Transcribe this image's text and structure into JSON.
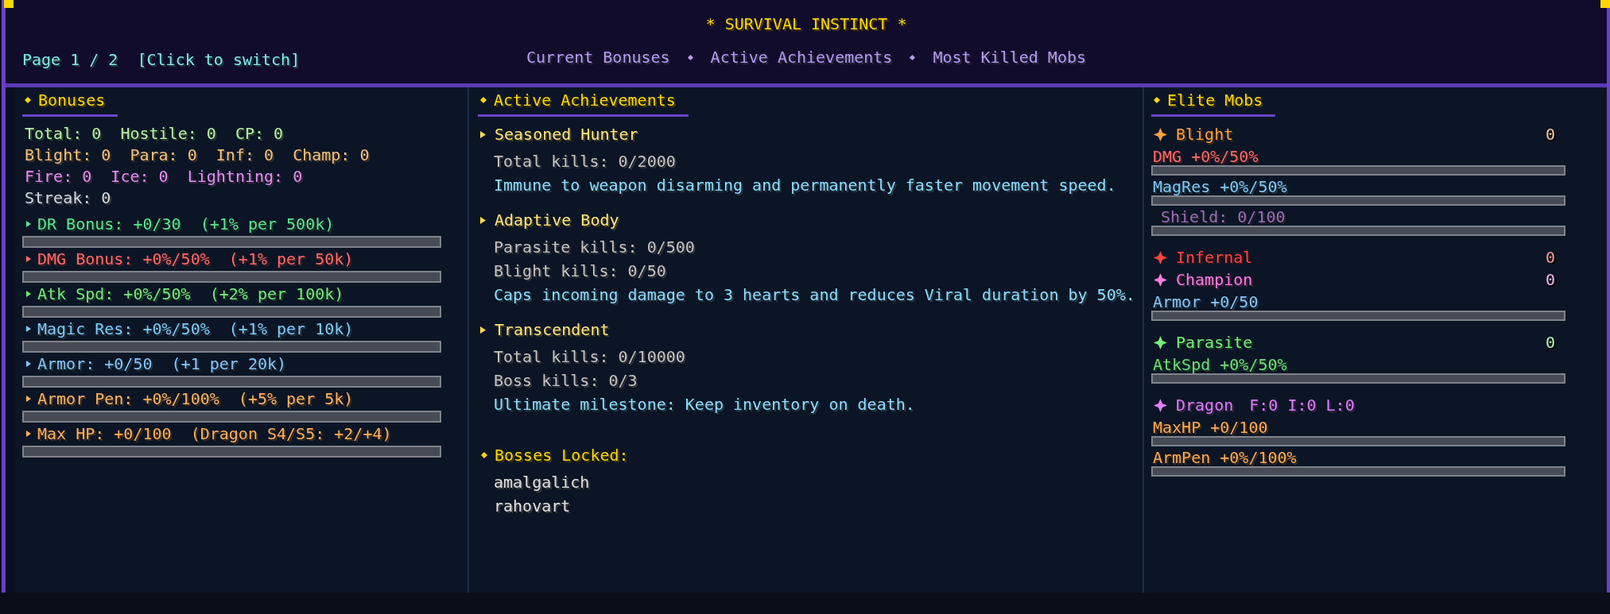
{
  "header": {
    "title": "* SURVIVAL INSTINCT *",
    "page_indicator": "Page 1 / 2  [Click to switch]",
    "nav": [
      "Current Bonuses",
      "Active Achievements",
      "Most Killed Mobs"
    ]
  },
  "bonuses": {
    "title": "Bonuses",
    "summary_lines": [
      {
        "text": "Total: 0  Hostile: 0  CP: 0",
        "color": "#b6f0a4"
      },
      {
        "text": "Blight: 0  Para: 0  Inf: 0  Champ: 0",
        "color": "#f2c27e"
      },
      {
        "text": "Fire: 0  Ice: 0  Lightning: 0",
        "color": "#e48ef2"
      },
      {
        "text": "Streak: 0",
        "color": "#d2dae8"
      }
    ],
    "rows": [
      {
        "label": "DR Bonus: +0/30  (+1% per 500k)",
        "color": "#5ee391",
        "level": 0
      },
      {
        "label": "DMG Bonus: +0%/50%  (+1% per 50k)",
        "color": "#ff6b6b",
        "level": 0
      },
      {
        "label": "Atk Spd: +0%/50%  (+2% per 100k)",
        "color": "#74ea7c",
        "level": 0
      },
      {
        "label": "Magic Res: +0%/50%  (+1% per 10k)",
        "color": "#7fc9f7",
        "level": 0
      },
      {
        "label": "Armor: +0/50  (+1 per 20k)",
        "color": "#86c6fa",
        "level": 0
      },
      {
        "label": "Armor Pen: +0%/100%  (+5% per 5k)",
        "color": "#ffb462",
        "level": 0
      },
      {
        "label": "Max HP: +0/100  (Dragon S4/S5: +2/+4)",
        "color": "#ffb05c",
        "level": 0
      }
    ]
  },
  "achievements": {
    "title": "Active Achievements",
    "items": [
      {
        "name": "Seasoned Hunter",
        "requirements": [
          "Total kills: 0/2000"
        ],
        "description": "Immune to weapon disarming and permanently faster movement speed."
      },
      {
        "name": "Adaptive Body",
        "requirements": [
          "Parasite kills: 0/500",
          "Blight kills: 0/50"
        ],
        "description": "Caps incoming damage to 3 hearts and reduces Viral duration by 50%."
      },
      {
        "name": "Transcendent",
        "requirements": [
          "Total kills: 0/10000",
          "Boss kills: 0/3"
        ],
        "description": "Ultimate milestone: Keep inventory on death."
      }
    ],
    "locked": {
      "title": "Bosses Locked:",
      "bosses": [
        "amalgalich",
        "rahovart"
      ]
    }
  },
  "elite_mobs": {
    "title": "Elite Mobs",
    "mobs": [
      {
        "name": "Blight",
        "color": "#ffa040",
        "count": "0",
        "stats": [
          {
            "kind": "stat",
            "label": "DMG +0%/50%",
            "color": "#ff6b6b",
            "level": 0
          },
          {
            "kind": "stat",
            "label": "MagRes +0%/50%",
            "color": "#7fc9f7",
            "level": 0
          },
          {
            "kind": "shield",
            "label": "Shield: 0/100",
            "color": "#9a70b2",
            "level": 0
          }
        ]
      },
      {
        "name": "Infernal",
        "color": "#ff4444",
        "count": "0"
      },
      {
        "name": "Champion",
        "color": "#ff7ae2",
        "count": "0",
        "stats": [
          {
            "kind": "stat",
            "label": "Armor +0/50",
            "color": "#86c6fa",
            "level": 0
          }
        ]
      },
      {
        "name": "Parasite",
        "color": "#78ee7a",
        "count": "0",
        "stats": [
          {
            "kind": "stat",
            "label": "AtkSpd +0%/50%",
            "color": "#6ee07a",
            "level": 0
          }
        ]
      },
      {
        "name": "Dragon",
        "color": "#e07cff",
        "extra": "F:0 I:0 L:0",
        "stats": [
          {
            "kind": "stat",
            "label": "MaxHP +0/100",
            "color": "#ffaa55",
            "level": 0
          },
          {
            "kind": "stat",
            "label": "ArmPen +0%/100%",
            "color": "#ffaa55",
            "level": 0
          }
        ]
      }
    ]
  }
}
